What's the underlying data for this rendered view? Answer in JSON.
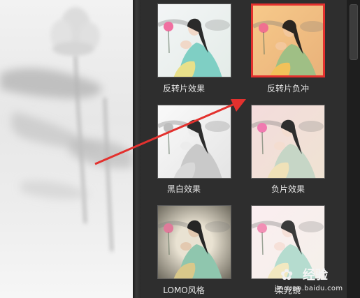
{
  "effects": [
    {
      "label": "反转片效果",
      "selected": false
    },
    {
      "label": "反转片负冲",
      "selected": true
    },
    {
      "label": "黑白效果",
      "selected": false
    },
    {
      "label": "负片效果",
      "selected": false
    },
    {
      "label": "LOMO风格",
      "selected": false
    },
    {
      "label": "柔光镜",
      "selected": false
    }
  ],
  "watermark": {
    "brand": "经验",
    "url": "jingyan.baidu.com"
  },
  "colors": {
    "selected_border": "#e3312e",
    "arrow": "#e3312e",
    "panel_bg": "#2e2e2e"
  }
}
